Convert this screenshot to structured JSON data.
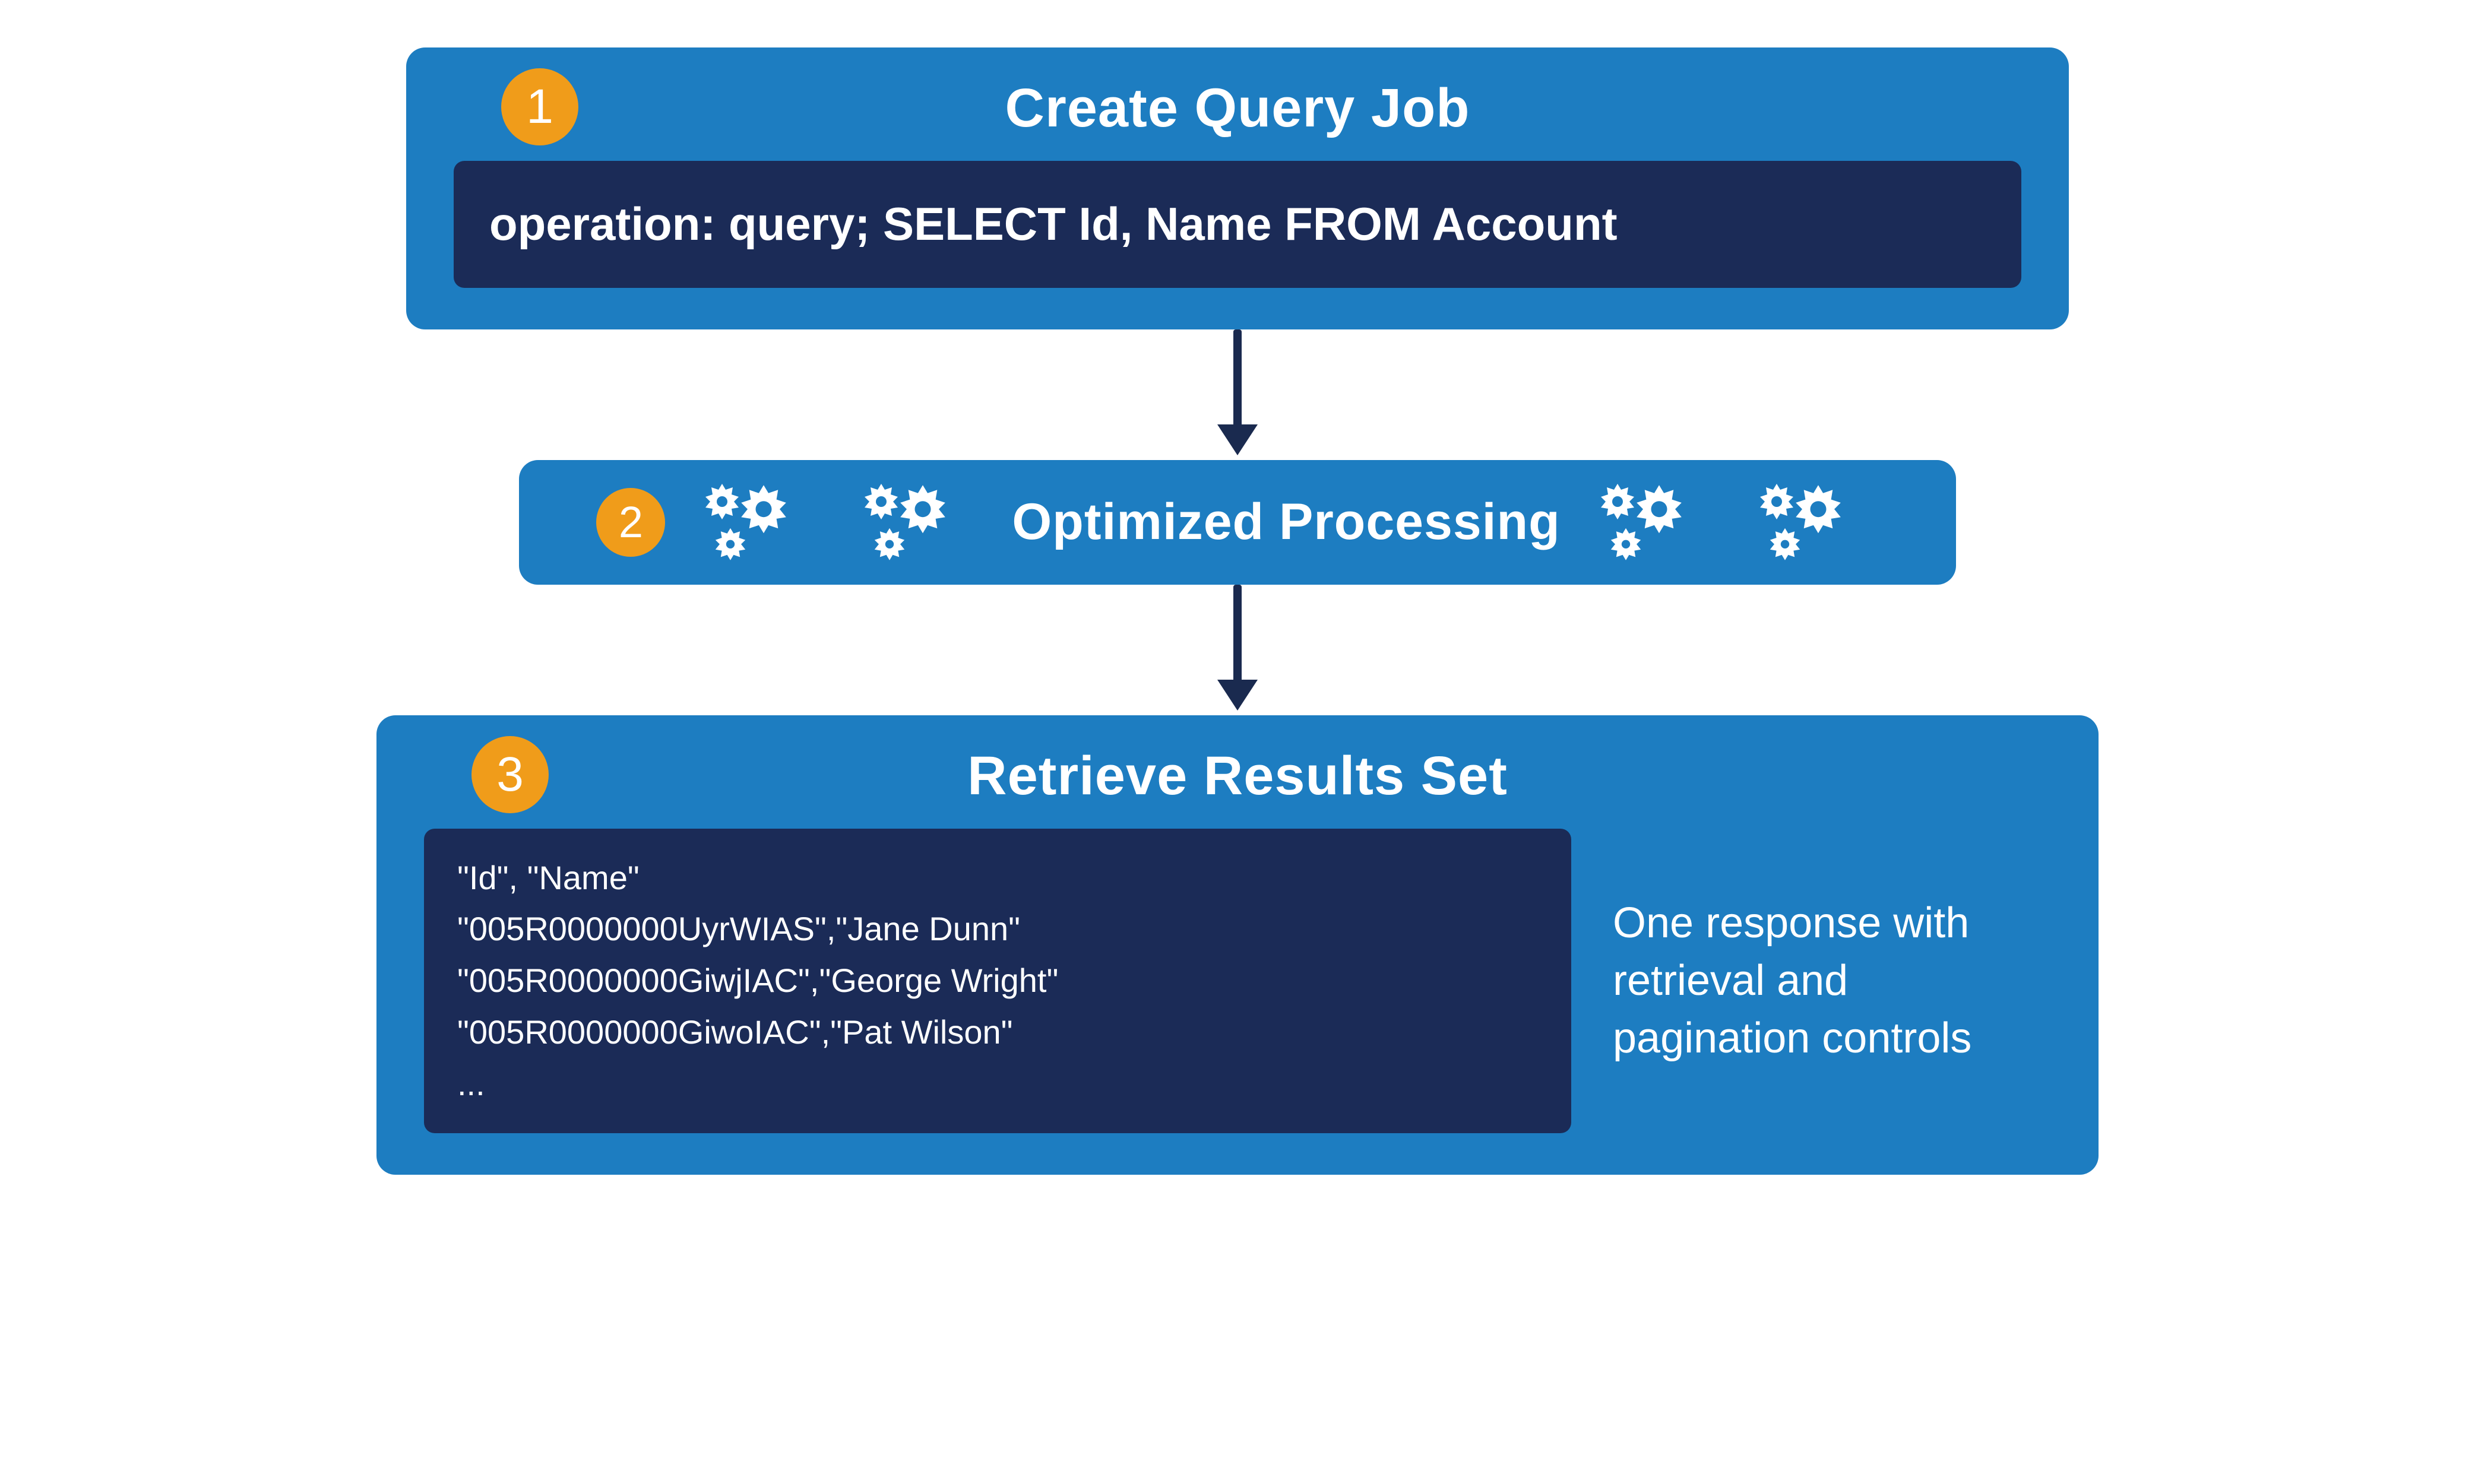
{
  "steps": {
    "step1": {
      "number": "1",
      "title": "Create Query Job",
      "code": "operation: query; SELECT Id, Name FROM Account"
    },
    "step2": {
      "number": "2",
      "title": "Optimized Processing"
    },
    "step3": {
      "number": "3",
      "title": "Retrieve Results Set",
      "result_lines": "\"Id\", \"Name\"\n\"005R0000000UyrWIAS\",\"Jane Dunn\"\n\"005R0000000GiwjIAC\",\"George Wright\"\n\"005R0000000GiwoIAC\",\"Pat Wilson\"\n...",
      "note": "One response with retrieval and pagination controls"
    }
  },
  "colors": {
    "panel": "#1d7dc1",
    "panel_dark": "#1b274f",
    "badge": "#f09c1a"
  }
}
